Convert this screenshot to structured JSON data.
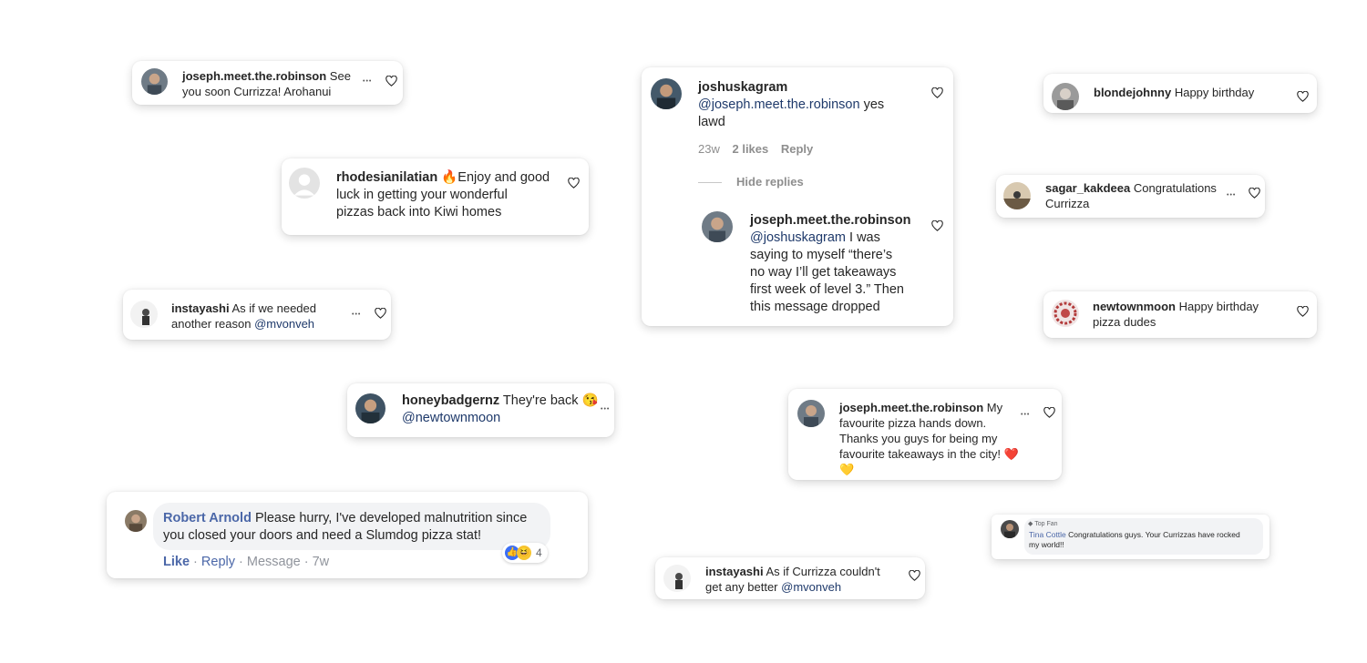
{
  "colors": {
    "mention": "#1f3a6b",
    "fb_name": "#4b67a8",
    "meta": "#8e8e8e"
  },
  "c1": {
    "user": "joseph.meet.the.robinson",
    "text1": " See",
    "text2": "you soon Currizza! Arohanui",
    "more": "•••"
  },
  "c2": {
    "user": "rhodesianilatian",
    "emoji": "🔥",
    "text1": "Enjoy and good",
    "text2": "luck in getting your wonderful",
    "text3": "pizzas back into Kiwi homes"
  },
  "c3": {
    "user": "instayashi",
    "text1": " As if we needed",
    "text2": "another reason ",
    "mention": "@mvonveh",
    "more": "•••"
  },
  "c4": {
    "user": "honeybadgernz",
    "text1": " They're back 😘",
    "mention": "@newtownmoon",
    "more": "•••"
  },
  "c5": {
    "user": "Robert Arnold",
    "text1": " Please hurry, I've developed malnutrition since",
    "text2": "you closed your doors and need a Slumdog pizza stat!",
    "like": "Like",
    "reply": "Reply",
    "message": "Message",
    "time": "7w",
    "sep": " · ",
    "reactions_count": "4"
  },
  "c6": {
    "user": "joshuskagram",
    "mention": "@joseph.meet.the.robinson",
    "text1": " yes",
    "text2": "lawd",
    "time": "23w",
    "likes": "2 likes",
    "reply": "Reply",
    "hide": "Hide replies",
    "reply_user": "joseph.meet.the.robinson",
    "reply_mention": "@joshuskagram",
    "reply_text1": " I was",
    "reply_text2": "saying to myself “there’s",
    "reply_text3": "no way I’ll get takeaways",
    "reply_text4": "first week of level 3.” Then",
    "reply_text5": "this message dropped"
  },
  "c7": {
    "user": "joseph.meet.the.robinson",
    "text1": " My",
    "text2": "favourite pizza hands down.",
    "text3": "Thanks you guys for being my",
    "text4": "favourite takeaways in the city! ❤️",
    "text5": "💛",
    "more": "•••"
  },
  "c8": {
    "user": "instayashi",
    "text1": " As if Currizza couldn't",
    "text2": "get any better ",
    "mention": "@mvonveh"
  },
  "c9": {
    "user": "blondejohnny",
    "text1": " Happy birthday"
  },
  "c10": {
    "user": "sagar_kakdeea",
    "text1": " Congratulations",
    "text2": "Currizza",
    "more": "•••"
  },
  "c11": {
    "user": "newtownmoon",
    "text1": " Happy birthday",
    "text2": "pizza dudes"
  },
  "c12": {
    "badge": "Top Fan",
    "user": "Tina Cottle",
    "text1": " Congratulations guys. Your Currizzas have rocked",
    "text2": "my world!!"
  }
}
